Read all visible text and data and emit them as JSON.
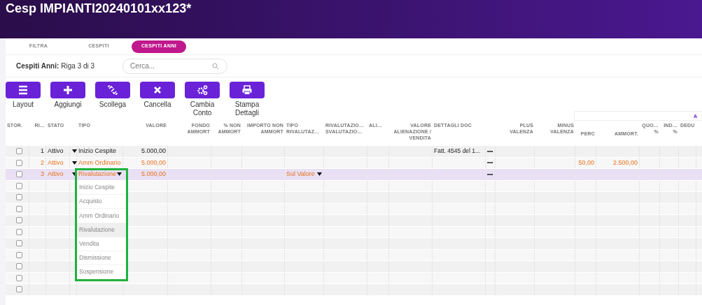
{
  "title": "Cesp IMPIANTI20240101xx123*",
  "tabs": [
    {
      "label": "FILTRA",
      "selected": false
    },
    {
      "label": "CESPITI",
      "selected": false
    },
    {
      "label": "CESPITI ANNI",
      "selected": true
    }
  ],
  "record_label": "Cespiti Anni:",
  "record_position": "Riga 3 di 3",
  "search": {
    "placeholder": "Cerca..."
  },
  "toolbar": [
    {
      "kind": "layout",
      "label": "Layout"
    },
    {
      "kind": "add",
      "label": "Aggiungi"
    },
    {
      "kind": "unlink",
      "label": "Scollega"
    },
    {
      "kind": "delete",
      "label": "Cancella"
    },
    {
      "kind": "settings",
      "label": "Cambia Conto"
    },
    {
      "kind": "print",
      "label": "Stampa Dettagli"
    }
  ],
  "group_header": "A",
  "columns": [
    "STOR.",
    "RI…",
    "STATO",
    "TIPO",
    "VALORE",
    "FONDO AMMORT",
    "% NON AMMORT",
    "IMPORTO NON AMMORT",
    "TIPO RIVALUTAZ…",
    "RIVALUTAZIO… SVALUTAZIO…",
    "ALI…",
    "VALORE ALIENAZIONE / VENDITA",
    "DETTAGLI DOC",
    "PLUS VALENZA",
    "MINUS VALENZA",
    "PERC",
    "AMMORT.",
    "QUO… %",
    "IND… %",
    "DEDU"
  ],
  "rows": [
    {
      "checked": false,
      "selected": false,
      "edited": false,
      "ri": "1",
      "stato": "Attivo",
      "tipo": "Inizio Cespite",
      "valore": "5.000,00",
      "dettagli_doc": "Fatt. 4545 del 1...",
      "details_button": "•••"
    },
    {
      "checked": false,
      "selected": false,
      "edited": true,
      "ri": "2",
      "stato": "Attivo",
      "tipo": "Amm Ordinario",
      "valore": "5.000,00",
      "details_button": "•••",
      "perc": "50,00",
      "ammort": "2.500,00"
    },
    {
      "checked": false,
      "selected": true,
      "edited": true,
      "ri": "3",
      "stato": "Attivo",
      "tipo": "Rivalutazione",
      "valore": "5.000,00",
      "tipo_rivalutazione": "Sul Valore",
      "details_button": "•••",
      "tipo_open": true,
      "options": [
        {
          "label": "Inizio Cespite",
          "selected": false
        },
        {
          "label": "Acquisto",
          "selected": false
        },
        {
          "label": "Amm Ordinario",
          "selected": false
        },
        {
          "label": "Rivalutazione",
          "selected": true
        },
        {
          "label": "Vendita",
          "selected": false
        },
        {
          "label": "Dismissione",
          "selected": false
        },
        {
          "label": "Sospensione",
          "selected": false
        }
      ]
    },
    {
      "checked": false,
      "selected": false
    },
    {
      "checked": false,
      "selected": false
    },
    {
      "checked": false,
      "selected": false
    },
    {
      "checked": false,
      "selected": false
    },
    {
      "checked": false,
      "selected": false
    },
    {
      "checked": false,
      "selected": false
    },
    {
      "checked": false,
      "selected": false
    },
    {
      "checked": false,
      "selected": false
    },
    {
      "checked": false,
      "selected": false
    },
    {
      "checked": false,
      "selected": false
    }
  ]
}
